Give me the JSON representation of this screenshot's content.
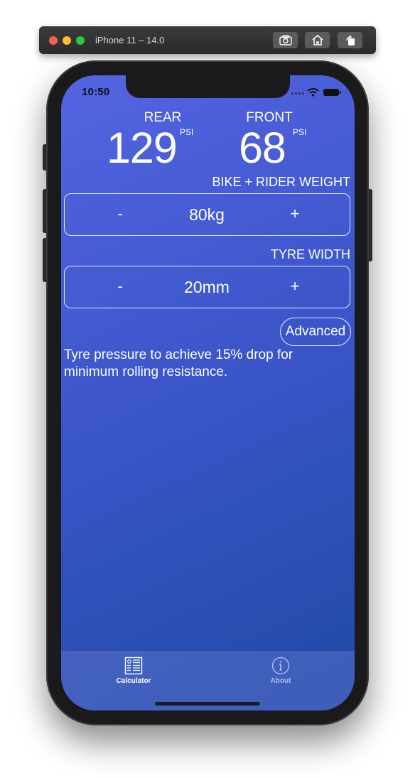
{
  "simulator": {
    "title": "iPhone 11 – 14.0",
    "buttons": [
      "screenshot-icon",
      "home-icon",
      "rotate-icon"
    ]
  },
  "status_bar": {
    "time": "10:50",
    "icons": [
      "signal-dots-icon",
      "wifi-icon",
      "battery-icon"
    ]
  },
  "readings": {
    "rear": {
      "label": "REAR",
      "value": "129",
      "unit": "PSI"
    },
    "front": {
      "label": "FRONT",
      "value": "68",
      "unit": "PSI"
    }
  },
  "weight": {
    "label": "BIKE + RIDER WEIGHT",
    "minus": "-",
    "value": "80kg",
    "plus": "+"
  },
  "tyre_width": {
    "label": "TYRE WIDTH",
    "minus": "-",
    "value": "20mm",
    "plus": "+"
  },
  "advanced_button": "Advanced",
  "description": "Tyre pressure to achieve 15% drop for minimum rolling resistance.",
  "tab_bar": {
    "tabs": [
      {
        "label": "Calculator",
        "icon": "calculator-icon",
        "selected": true
      },
      {
        "label": "About",
        "icon": "info-icon",
        "selected": false
      }
    ]
  },
  "colors": {
    "gradient_start": "#5464e2",
    "gradient_end": "#1e4aa4",
    "text": "#ffffff"
  }
}
